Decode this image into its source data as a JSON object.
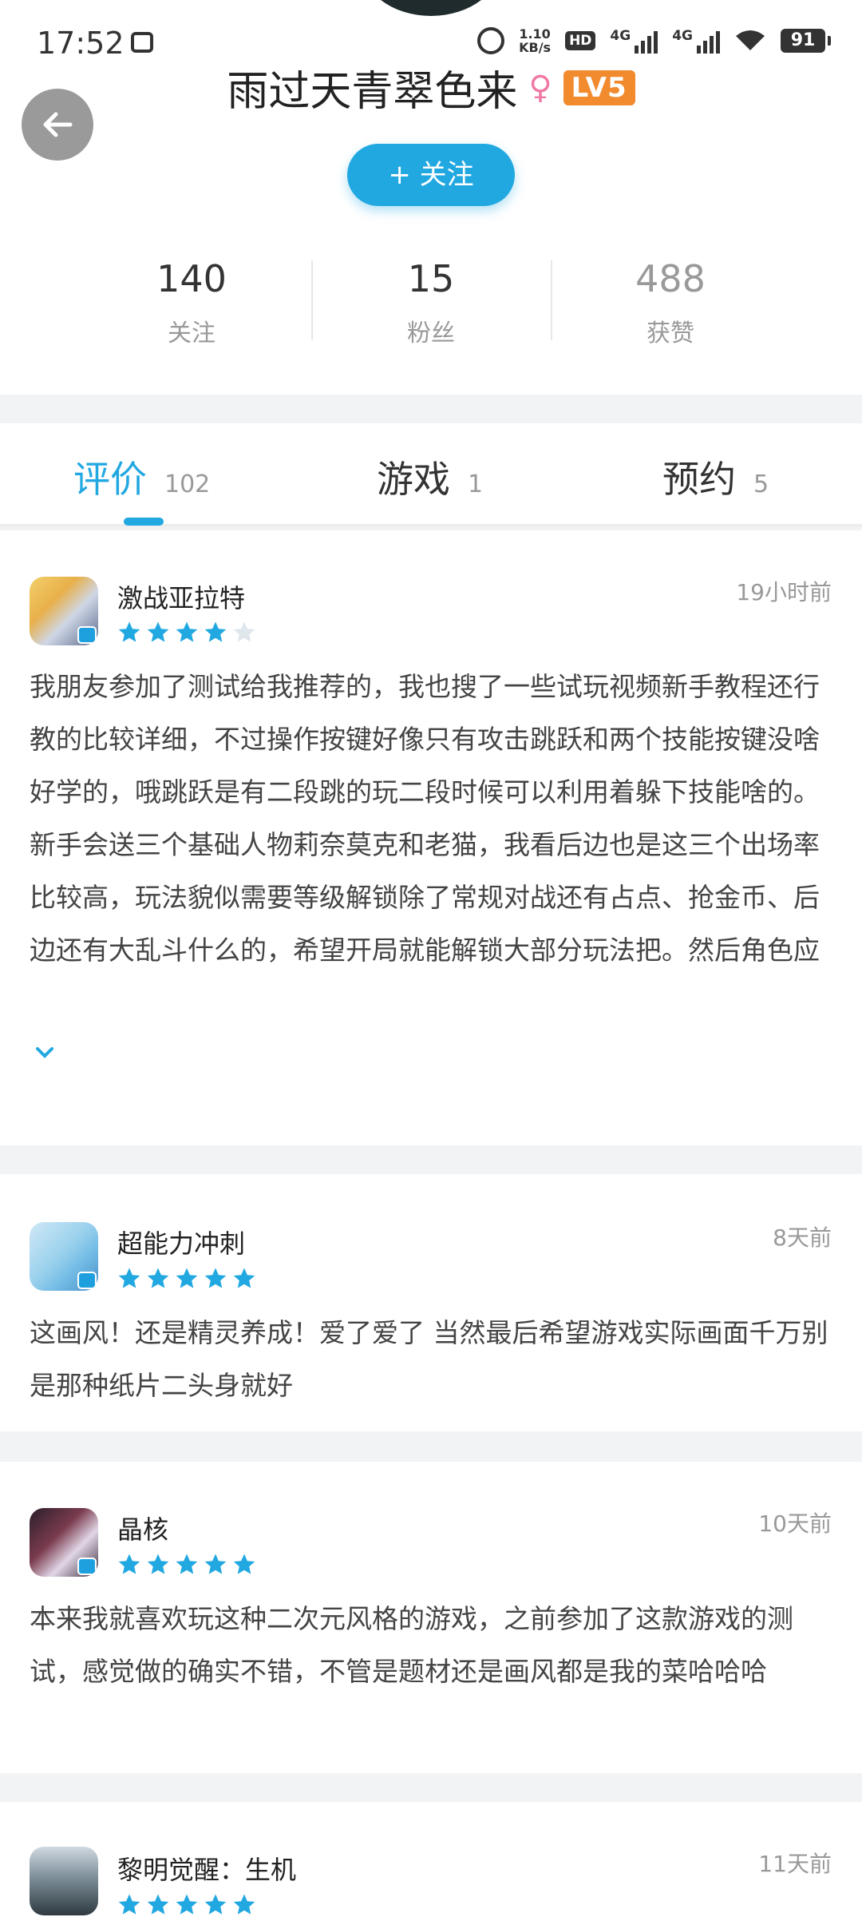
{
  "status_bar": {
    "time": "17:52",
    "speed_value": "1.10",
    "speed_unit": "KB/s",
    "hd": "HD",
    "net1": "4G",
    "net2": "4G",
    "battery": "91"
  },
  "profile": {
    "username": "雨过天青翠色来",
    "gender_icon": "♀",
    "level": "LV5",
    "follow_label": "+ 关注",
    "stats": [
      {
        "value": "140",
        "label": "关注"
      },
      {
        "value": "15",
        "label": "粉丝"
      },
      {
        "value": "488",
        "label": "获赞"
      }
    ]
  },
  "tabs": [
    {
      "label": "评价",
      "count": "102",
      "active": true
    },
    {
      "label": "游戏",
      "count": "1",
      "active": false
    },
    {
      "label": "预约",
      "count": "5",
      "active": false
    }
  ],
  "reviews": [
    {
      "game": "激战亚拉特",
      "time": "19小时前",
      "rating": 4,
      "text": "我朋友参加了测试给我推荐的，我也搜了一些试玩视频新手教程还行教的比较详细，不过操作按键好像只有攻击跳跃和两个技能按键没啥好学的，哦跳跃是有二段跳的玩二段时候可以利用着躲下技能啥的。新手会送三个基础人物莉奈莫克和老猫，我看后边也是这三个出场率比较高，玩法貌似需要等级解锁除了常规对战还有占点、抢金币、后边还有大乱斗什么的，希望开局就能解锁大部分玩法把。然后角色应该是不用抽卡招募都是升级送的或者"
    },
    {
      "game": "超能力冲刺",
      "time": "8天前",
      "rating": 5,
      "text": "这画风！还是精灵养成！爱了爱了 当然最后希望游戏实际画面千万别是那种纸片二头身就好"
    },
    {
      "game": "晶核",
      "time": "10天前",
      "rating": 5,
      "text": "本来我就喜欢玩这种二次元风格的游戏，之前参加了这款游戏的测试，感觉做的确实不错，不管是题材还是画风都是我的菜哈哈哈"
    },
    {
      "game": "黎明觉醒：生机",
      "time": "11天前",
      "rating": 5,
      "text": ""
    }
  ],
  "colors": {
    "accent": "#22a8e1",
    "level_badge": "#f28a2e",
    "gender": "#f07aa5",
    "star_empty": "#dfe6ec"
  },
  "icons": {
    "back": "arrow-left-icon",
    "expand": "chevron-down-icon",
    "star": "star-icon"
  }
}
